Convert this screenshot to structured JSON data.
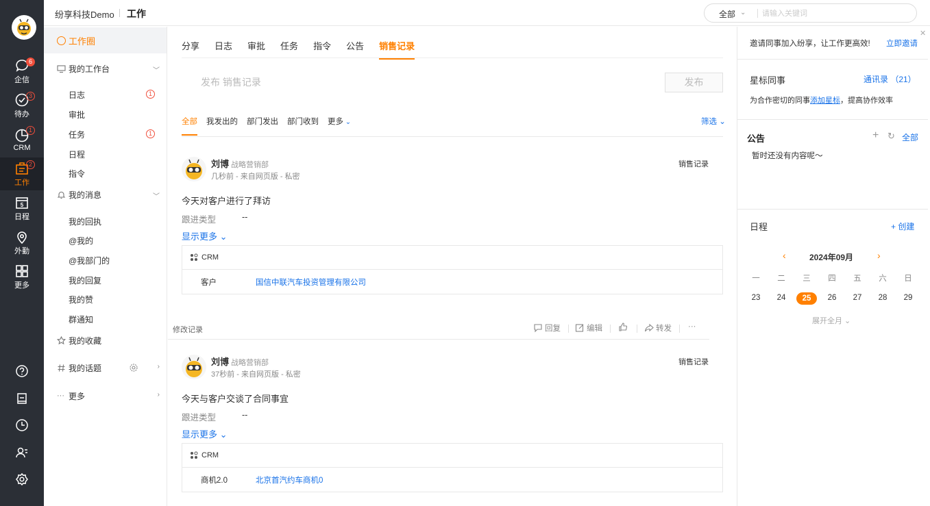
{
  "rail": {
    "items": [
      {
        "label": "企信",
        "badge": "6",
        "icon": "chat-icon"
      },
      {
        "label": "待办",
        "badge": "3",
        "icon": "check-circle-icon"
      },
      {
        "label": "CRM",
        "badge": "1",
        "icon": "crm-chart-icon"
      },
      {
        "label": "工作",
        "badge": "2",
        "icon": "work-icon"
      },
      {
        "label": "日程",
        "day": "5",
        "icon": "calendar-icon"
      },
      {
        "label": "外勤",
        "icon": "location-icon"
      },
      {
        "label": "更多",
        "icon": "grid-icon"
      }
    ]
  },
  "topbar": {
    "company": "纷享科技Demo",
    "section": "工作",
    "search_scope": "全部",
    "search_placeholder": "请输入关键词"
  },
  "leftnav": {
    "top": "工作圈",
    "workbench": "我的工作台",
    "workbench_items": [
      {
        "label": "日志",
        "badge": "1"
      },
      {
        "label": "审批"
      },
      {
        "label": "任务",
        "badge": "1"
      },
      {
        "label": "日程"
      },
      {
        "label": "指令"
      }
    ],
    "messages": "我的消息",
    "message_items": [
      "我的回执",
      "@我的",
      "@我部门的",
      "我的回复",
      "我的赞",
      "群通知"
    ],
    "favorites": "我的收藏",
    "topics": "我的话题",
    "more": "更多"
  },
  "main": {
    "tabs": [
      "分享",
      "日志",
      "审批",
      "任务",
      "指令",
      "公告",
      "销售记录"
    ],
    "active_tab": "销售记录",
    "publish_placeholder": "发布 销售记录",
    "publish_button": "发布",
    "filters": [
      "全部",
      "我发出的",
      "部门发出",
      "部门收到",
      "更多"
    ],
    "screen": "筛选",
    "posts": [
      {
        "name": "刘博",
        "dept": "战略营销部",
        "meta": "几秒前 - 来自网页版 - 私密",
        "type": "销售记录",
        "text": "今天对客户进行了拜访",
        "field_label": "跟进类型",
        "field_value": "--",
        "show_more": "显示更多",
        "crm_label": "CRM",
        "crm_key": "客户",
        "crm_value": "国信中联汽车投资管理有限公司"
      },
      {
        "name": "刘博",
        "dept": "战略营销部",
        "meta": "37秒前 - 来自网页版 - 私密",
        "type": "销售记录",
        "text": "今天与客户交谈了合同事宜",
        "field_label": "跟进类型",
        "field_value": "--",
        "show_more": "显示更多",
        "crm_label": "CRM",
        "crm_key": "商机2.0",
        "crm_value": "北京首汽约车商机0"
      }
    ],
    "actions": {
      "edit_record": "修改记录",
      "reply": "回复",
      "edit": "编辑",
      "forward": "转发",
      "more": "···"
    }
  },
  "right": {
    "invite": "邀请同事加入纷享，让工作更高效!",
    "invite_link": "立即邀请",
    "star_title": "星标同事",
    "contacts": "通讯录 （21）",
    "star_desc_pre": "为合作密切的同事",
    "star_desc_link": "添加星标",
    "star_desc_post": "，提高协作效率",
    "ann_title": "公告",
    "ann_all": "全部",
    "ann_empty": "暂时还没有内容呢～",
    "sch_title": "日程",
    "sch_create": "+ 创建",
    "cal_month": "2024年09月",
    "weekdays": [
      "一",
      "二",
      "三",
      "四",
      "五",
      "六",
      "日"
    ],
    "days": [
      "23",
      "24",
      "25",
      "26",
      "27",
      "28",
      "29"
    ],
    "today": "25",
    "expand": "展开全月"
  },
  "colors": {
    "accent": "#ff8000",
    "link": "#1a73e8",
    "rail": "#2b2f36",
    "badge": "#f04e3b"
  }
}
